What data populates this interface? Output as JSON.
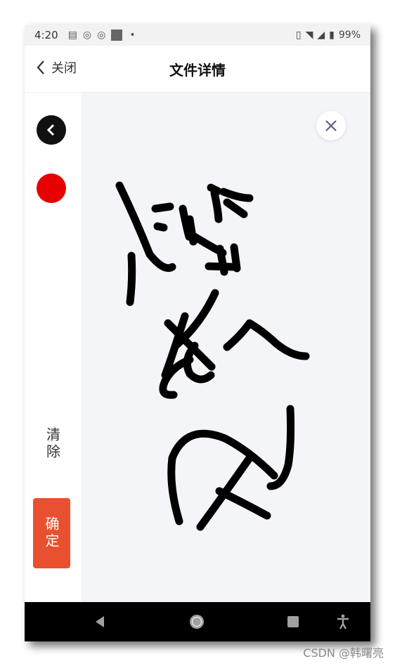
{
  "status_bar": {
    "time": "4:20",
    "battery": "99%"
  },
  "header": {
    "back_label": "关闭",
    "title": "文件详情"
  },
  "sidebar": {
    "clear_label": "清除",
    "confirm_label": "确定"
  },
  "colors": {
    "brush": "#e60000",
    "confirm": "#e8502f",
    "canvas_bg": "#f4f5f9"
  },
  "icons": {
    "status": [
      "message-icon",
      "weibo-icon",
      "weibo-icon",
      "app-square-icon",
      "dot-icon",
      "vibrate-icon",
      "wifi-icon",
      "signal-icon",
      "battery-icon"
    ],
    "nav": [
      "back-triangle-icon",
      "home-circle-icon",
      "recents-square-icon",
      "accessibility-icon"
    ]
  },
  "watermark": "CSDN @韩曙亮"
}
